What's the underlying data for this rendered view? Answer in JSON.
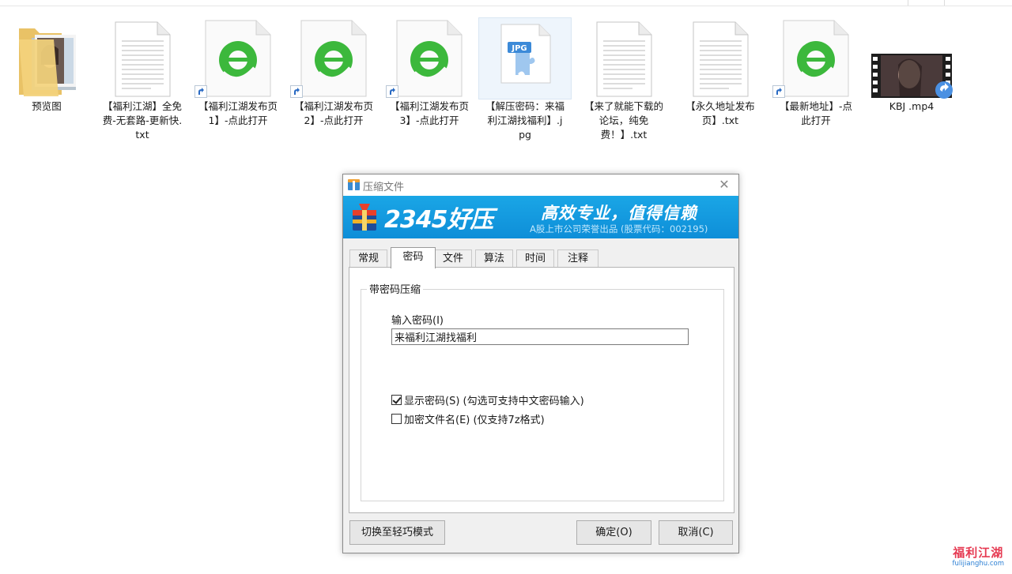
{
  "desktop": {
    "files": [
      {
        "name": "预览图",
        "kind": "folder"
      },
      {
        "name": "【福利江湖】全免费-无套路-更新快.txt",
        "kind": "txt"
      },
      {
        "name": "【福利江湖发布页1】-点此打开",
        "kind": "url"
      },
      {
        "name": "【福利江湖发布页2】-点此打开",
        "kind": "url"
      },
      {
        "name": "【福利江湖发布页3】-点此打开",
        "kind": "url"
      },
      {
        "name": "【解压密码：来福利江湖找福利】.jpg",
        "kind": "jpg",
        "badge": "JPG"
      },
      {
        "name": "【来了就能下载的论坛，纯免费！】.txt",
        "kind": "txt"
      },
      {
        "name": "【永久地址发布页】.txt",
        "kind": "txt"
      },
      {
        "name": "【最新地址】-点此打开",
        "kind": "url"
      },
      {
        "name": "KBJ .mp4",
        "kind": "video"
      }
    ]
  },
  "dialog": {
    "title": "压缩文件",
    "banner": {
      "brand": "2345好压",
      "slogan": "高效专业，值得信赖",
      "sub": "A股上市公司荣誉出品 (股票代码：002195)"
    },
    "tabs": [
      "常规",
      "密码",
      "文件",
      "算法",
      "时间",
      "注释"
    ],
    "active_tab": "密码",
    "group_label": "带密码压缩",
    "password_label": "输入密码(I)",
    "password_value": "来福利江湖找福利",
    "show_password": {
      "label": "显示密码(S)  (勾选可支持中文密码输入)",
      "checked": true
    },
    "encrypt_names": {
      "label": "加密文件名(E)  (仅支持7z格式)",
      "checked": false
    },
    "buttons": {
      "switch_mode": "切换至轻巧模式",
      "ok": "确定(O)",
      "cancel": "取消(C)"
    }
  },
  "watermark": {
    "top": "福利江湖",
    "bottom": "fulijianghu.com"
  },
  "colors": {
    "banner": "#1aa6e6",
    "ie_green": "#3cb83c",
    "jpg_blue": "#3c8ad8"
  }
}
